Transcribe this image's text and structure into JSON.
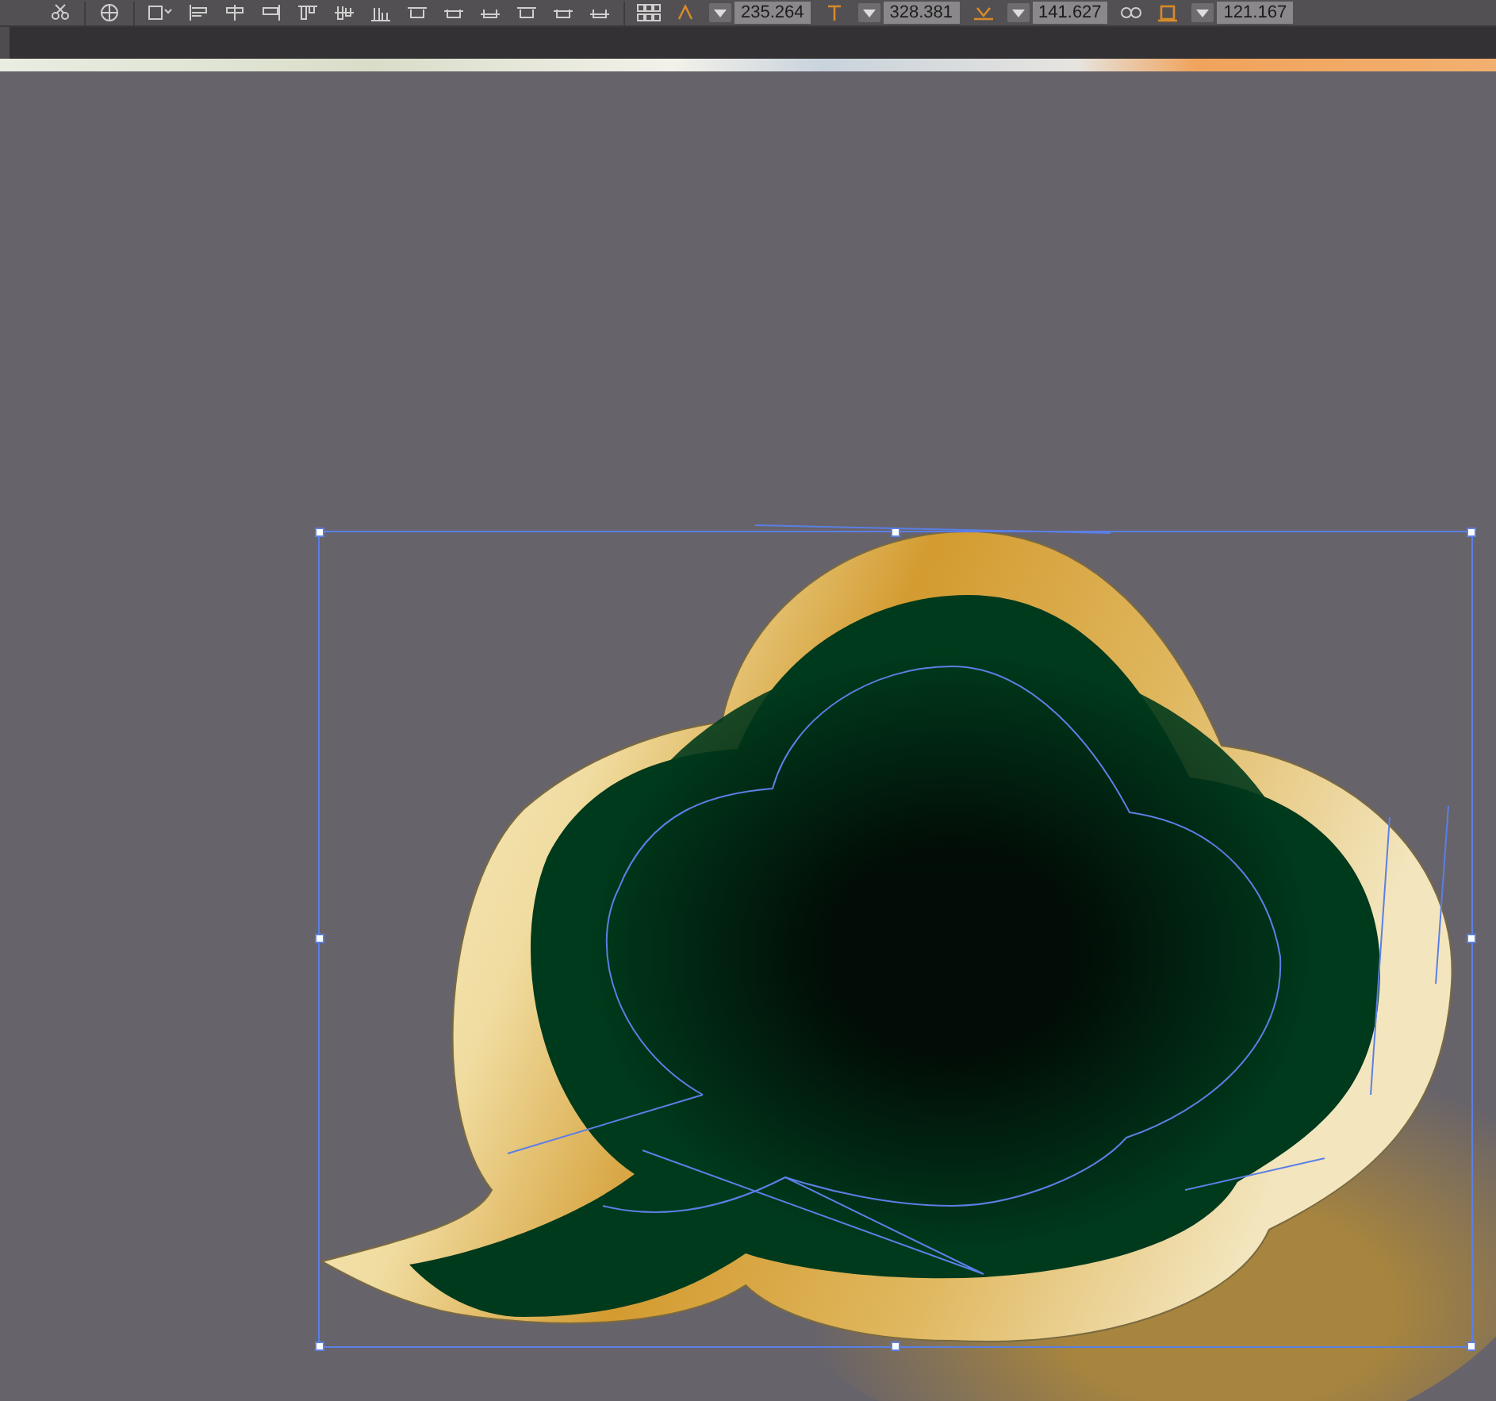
{
  "toolbar": {
    "fields": [
      {
        "kind": "x",
        "value": "235.264"
      },
      {
        "kind": "y",
        "value": "328.381"
      },
      {
        "kind": "width",
        "value": "141.627"
      },
      {
        "kind": "height",
        "value": "121.167"
      }
    ]
  }
}
